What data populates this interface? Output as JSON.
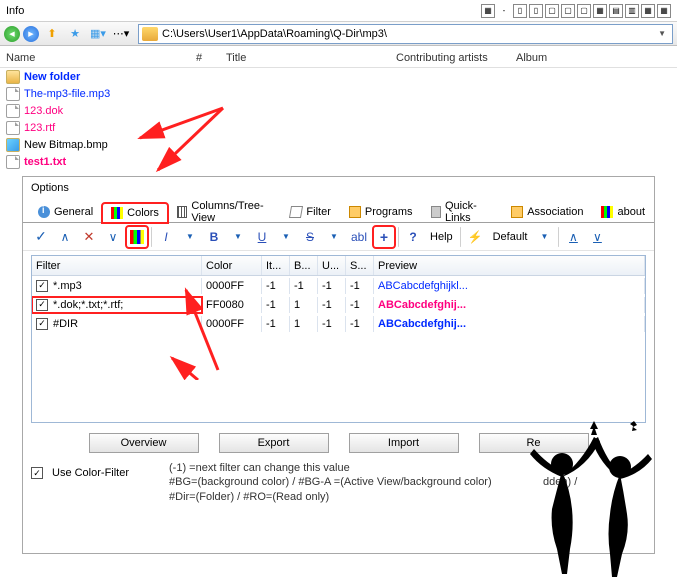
{
  "window": {
    "title": "Info"
  },
  "address": {
    "path": "C:\\Users\\User1\\AppData\\Roaming\\Q-Dir\\mp3\\"
  },
  "columns": {
    "name": "Name",
    "hash": "#",
    "title": "Title",
    "contrib": "Contributing artists",
    "album": "Album"
  },
  "files": {
    "items": [
      {
        "label": "New folder",
        "style": "bold blue",
        "icon": "folder"
      },
      {
        "label": "The-mp3-file.mp3",
        "style": "blue",
        "icon": "doc"
      },
      {
        "label": "123.dok",
        "style": "magenta",
        "icon": "doc"
      },
      {
        "label": "123.rtf",
        "style": "magenta",
        "icon": "doc"
      },
      {
        "label": "New Bitmap.bmp",
        "style": "black",
        "icon": "bmp"
      },
      {
        "label": "test1.txt",
        "style": "bold magenta",
        "icon": "doc"
      }
    ]
  },
  "options": {
    "title": "Options",
    "tabs": [
      "General",
      "Colors",
      "Columns/Tree-View",
      "Filter",
      "Programs",
      "Quick-Links",
      "Association",
      "about"
    ],
    "help_label": "Help",
    "default_label": "Default"
  },
  "grid": {
    "headers": {
      "filter": "Filter",
      "color": "Color",
      "it": "It...",
      "b": "B...",
      "u": "U...",
      "s": "S...",
      "preview": "Preview"
    },
    "rows": [
      {
        "checked": true,
        "filter": "*.mp3",
        "color": "0000FF",
        "it": "-1",
        "b": "-1",
        "u": "-1",
        "s": "-1",
        "preview": "ABCabcdefghijkl...",
        "pstyle": "prev-blue"
      },
      {
        "checked": true,
        "filter": "*.dok;*.txt;*.rtf;",
        "color": "FF0080",
        "it": "-1",
        "b": "1",
        "u": "-1",
        "s": "-1",
        "preview": "ABCabcdefghij...",
        "pstyle": "prev-mag",
        "redrow": true
      },
      {
        "checked": true,
        "filter": "#DIR",
        "color": "0000FF",
        "it": "-1",
        "b": "1",
        "u": "-1",
        "s": "-1",
        "preview": "ABCabcdefghij...",
        "pstyle": "prev-blueb"
      }
    ]
  },
  "buttons": {
    "overview": "Overview",
    "export": "Export",
    "import": "Import",
    "reset": "Re"
  },
  "footer": {
    "use_color_filter": "Use Color-Filter",
    "hint1": "(-1) =next filter can change this value",
    "hint2": "#BG=(background color) / #BG-A =(Active View/background color)",
    "hint2b": "dden) /",
    "hint3": "#Dir=(Folder) / #RO=(Read only)"
  }
}
